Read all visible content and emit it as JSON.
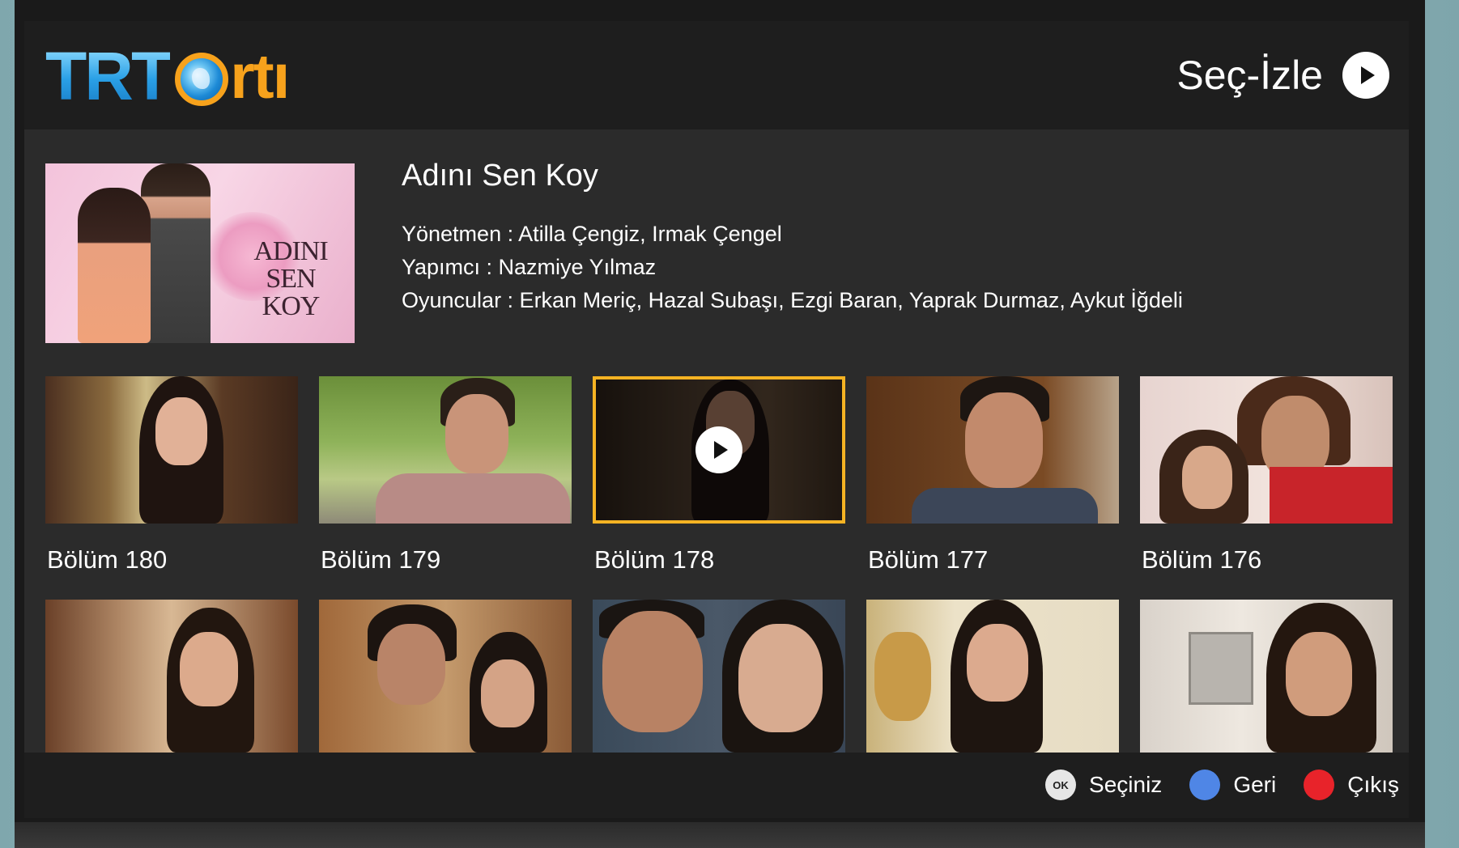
{
  "header": {
    "logo_trt": "TRT",
    "logo_arti": "rtı",
    "sec_izle_label": "Seç-İzle"
  },
  "show": {
    "poster_title_lines": [
      "ADINI",
      "SEN",
      "KOY"
    ],
    "title": "Adını Sen Koy",
    "director_line": "Yönetmen : Atilla Çengiz, Irmak Çengel",
    "producer_line": "Yapımcı : Nazmiye Yılmaz",
    "cast_line": "Oyuncular : Erkan Meriç, Hazal Subaşı, Ezgi Baran, Yaprak Durmaz, Aykut İğdeli"
  },
  "episodes": [
    {
      "label": "Bölüm 180"
    },
    {
      "label": "Bölüm 179"
    },
    {
      "label": "Bölüm 178",
      "focused": true
    },
    {
      "label": "Bölüm 177"
    },
    {
      "label": "Bölüm 176"
    }
  ],
  "footer": {
    "ok_badge": "OK",
    "select_label": "Seçiniz",
    "back_label": "Geri",
    "exit_label": "Çıkış",
    "colors": {
      "back": "#4f86e6",
      "exit": "#e8232a",
      "focus": "#f5b323",
      "brand_orange": "#f7a21c",
      "brand_blue": "#2aa0e6"
    }
  }
}
